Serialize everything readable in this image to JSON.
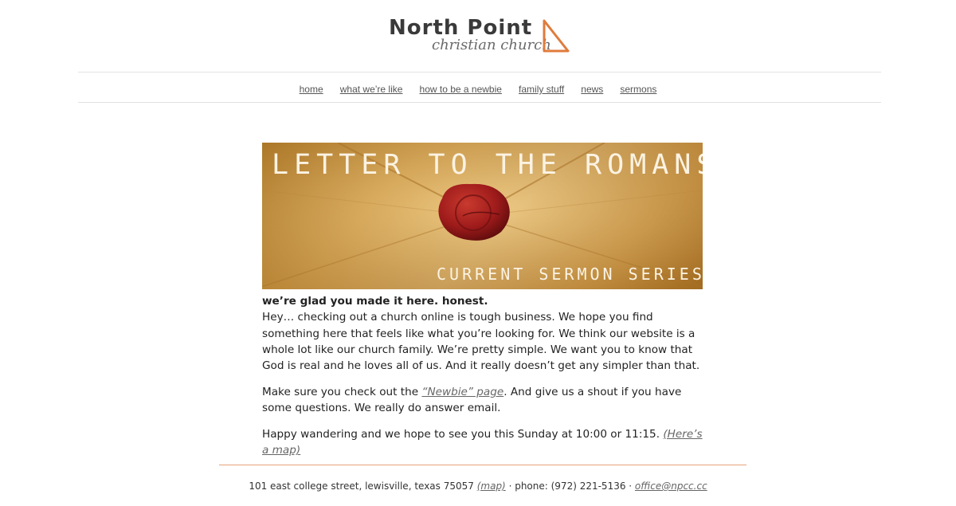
{
  "header": {
    "logo_line1": "North Point",
    "logo_line2": "christian church"
  },
  "nav": {
    "items": [
      {
        "label": "home"
      },
      {
        "label": "what we’re like"
      },
      {
        "label": "how to be a newbie"
      },
      {
        "label": "family stuff"
      },
      {
        "label": "news"
      },
      {
        "label": "sermons"
      }
    ]
  },
  "banner": {
    "title": "LETTER TO THE ROMANS",
    "subtitle": "CURRENT SERMON SERIES",
    "colors": {
      "paper": "#e3b25a",
      "wax": "#9e1b1b",
      "text": "#fbf3e3"
    }
  },
  "content": {
    "lead": "we’re glad you made it here. honest.",
    "p1": "Hey… checking out a church online is tough business. We hope you find something here that feels like what you’re looking for. We think our website is a whole lot like our church family. We’re pretty simple. We want you to know that God is real and he loves all of us. And it really doesn’t get any simpler than that.",
    "p2_before": "Make sure you check out the ",
    "p2_link": "“Newbie” page",
    "p2_after": ". And give us a shout if you have some questions. We really do answer email.",
    "p3_before": "Happy wandering and we hope to see you this Sunday at 10:00 or 11:15. ",
    "p3_link": "(Here’s a map)"
  },
  "footer": {
    "address": "101 east college street, lewisville, texas 75057",
    "map_link": "(map)",
    "sep1": " · ",
    "phone": "phone: (972) 221-5136",
    "sep2": " · ",
    "email": "office@npcc.cc"
  },
  "colors": {
    "accent": "#e07b3c",
    "footer_rule": "#e6a27a",
    "nav_rule": "#e2e2e2"
  }
}
